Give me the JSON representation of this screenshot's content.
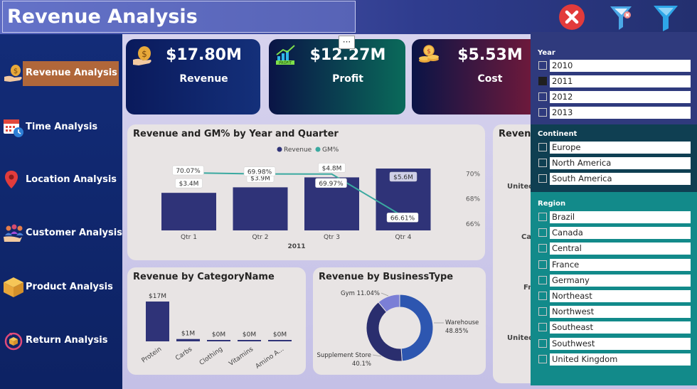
{
  "header": {
    "title": "Revenue Analysis"
  },
  "nav": [
    {
      "label": "Revenue Analysis",
      "active": true
    },
    {
      "label": "Time Analysis"
    },
    {
      "label": "Location Analysis"
    },
    {
      "label": "Customer Analysis"
    },
    {
      "label": "Product Analysis"
    },
    {
      "label": "Return Analysis"
    }
  ],
  "kpis": [
    {
      "value": "$17.80M",
      "label": "Revenue",
      "icon": "money-bag-icon"
    },
    {
      "value": "$12.27M",
      "label": "Profit",
      "icon": "profit-chart-icon"
    },
    {
      "value": "$5.53M",
      "label": "Cost",
      "icon": "coins-icon"
    }
  ],
  "more_options": "···",
  "revenue_gm": {
    "title": "Revenue and GM% by Year and Quarter",
    "legend": [
      "Revenue",
      "GM%"
    ],
    "year_label": "2011"
  },
  "category": {
    "title": "Revenue by CategoryName"
  },
  "business": {
    "title": "Revenue by BusinessType"
  },
  "partial_card": {
    "title": "Revenu",
    "labels": [
      "United",
      "Ca",
      "Fr",
      "United"
    ]
  },
  "filters": {
    "year": {
      "title": "Year",
      "options": [
        "2010",
        "2011",
        "2012",
        "2013"
      ],
      "selected": "2011"
    },
    "continent": {
      "title": "Continent",
      "options": [
        "Europe",
        "North America",
        "South America"
      ]
    },
    "region": {
      "title": "Region",
      "options": [
        "Brazil",
        "Canada",
        "Central",
        "France",
        "Germany",
        "Northeast",
        "Northwest",
        "Southeast",
        "Southwest",
        "United Kingdom"
      ]
    }
  },
  "colors": {
    "bar": "#2f3378",
    "line": "#3aa9a0",
    "active_nav": "#b0673a"
  },
  "chart_data": [
    {
      "type": "bar",
      "title": "Revenue and GM% by Year and Quarter",
      "categories": [
        "Qtr 1",
        "Qtr 2",
        "Qtr 3",
        "Qtr 4"
      ],
      "xlabel": "2011",
      "series": [
        {
          "name": "Revenue",
          "values": [
            3.4,
            3.9,
            4.8,
            5.6
          ],
          "labels": [
            "$3.4M",
            "$3.9M",
            "$4.8M",
            "$5.6M"
          ]
        },
        {
          "name": "GM%",
          "type": "line",
          "values": [
            70.07,
            69.98,
            69.97,
            66.61
          ],
          "labels": [
            "70.07%",
            "69.98%",
            "69.97%",
            "66.61%"
          ]
        }
      ],
      "y2_ticks": [
        "70%",
        "68%",
        "66%"
      ],
      "y2lim": [
        65.5,
        71.2
      ],
      "ylim": [
        0,
        6.5
      ]
    },
    {
      "type": "bar",
      "title": "Revenue by CategoryName",
      "categories": [
        "Protein",
        "Carbs",
        "Clothing",
        "Vitamins",
        "Amino A..."
      ],
      "values": [
        17,
        1,
        0,
        0,
        0
      ],
      "labels": [
        "$17M",
        "$1M",
        "$0M",
        "$0M",
        "$0M"
      ],
      "ylim": [
        0,
        17
      ]
    },
    {
      "type": "pie",
      "title": "Revenue by BusinessType",
      "donut": true,
      "slices": [
        {
          "name": "Warehouse",
          "value": 48.85,
          "label": "48.85%"
        },
        {
          "name": "Supplement Store",
          "value": 40.1,
          "label": "40.1%"
        },
        {
          "name": "Gym",
          "value": 11.04,
          "label": "11.04%"
        }
      ]
    }
  ]
}
